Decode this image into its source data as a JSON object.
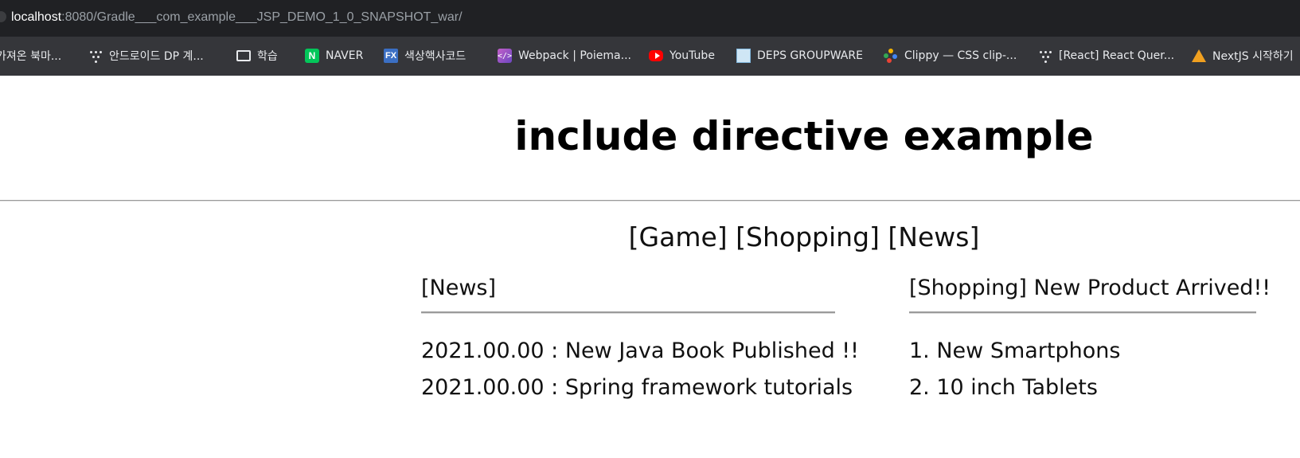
{
  "browser": {
    "url_host": "localhost",
    "url_path": ":8080/Gradle___com_example___JSP_DEMO_1_0_SNAPSHOT_war/",
    "bookmarks": [
      {
        "label": "가져온 북마...",
        "icon": "none"
      },
      {
        "label": "안드로이드 DP 계...",
        "icon": "dots-icon"
      },
      {
        "label": "학습",
        "icon": "folder-icon"
      },
      {
        "label": "NAVER",
        "icon": "naver-icon"
      },
      {
        "label": "색상핵사코드",
        "icon": "fx-icon"
      },
      {
        "label": "Webpack | Poiema...",
        "icon": "webpack-icon"
      },
      {
        "label": "YouTube",
        "icon": "youtube-icon"
      },
      {
        "label": "DEPS GROUPWARE",
        "icon": "deps-icon"
      },
      {
        "label": "Clippy — CSS clip-...",
        "icon": "clippy-icon"
      },
      {
        "label": "[React] React Quer...",
        "icon": "dots-icon"
      },
      {
        "label": "NextJS 시작하기",
        "icon": "nextjs-icon"
      }
    ]
  },
  "page": {
    "title": "include directive example",
    "nav": [
      "[Game]",
      "[Shopping]",
      "[News]"
    ],
    "news": {
      "heading": "[News]",
      "items": [
        "2021.00.00 : New Java Book Published !!",
        "2021.00.00 : Spring framework tutorials"
      ]
    },
    "shopping": {
      "heading": "[Shopping] New Product Arrived!!",
      "items": [
        "1. New Smartphons",
        "2. 10 inch Tablets"
      ]
    }
  },
  "colors": {
    "address_bar": "#202124",
    "bookmarks_bar": "#35363a",
    "naver": "#03c75a",
    "youtube": "#ff0000",
    "rule": "#9a9a9a"
  }
}
